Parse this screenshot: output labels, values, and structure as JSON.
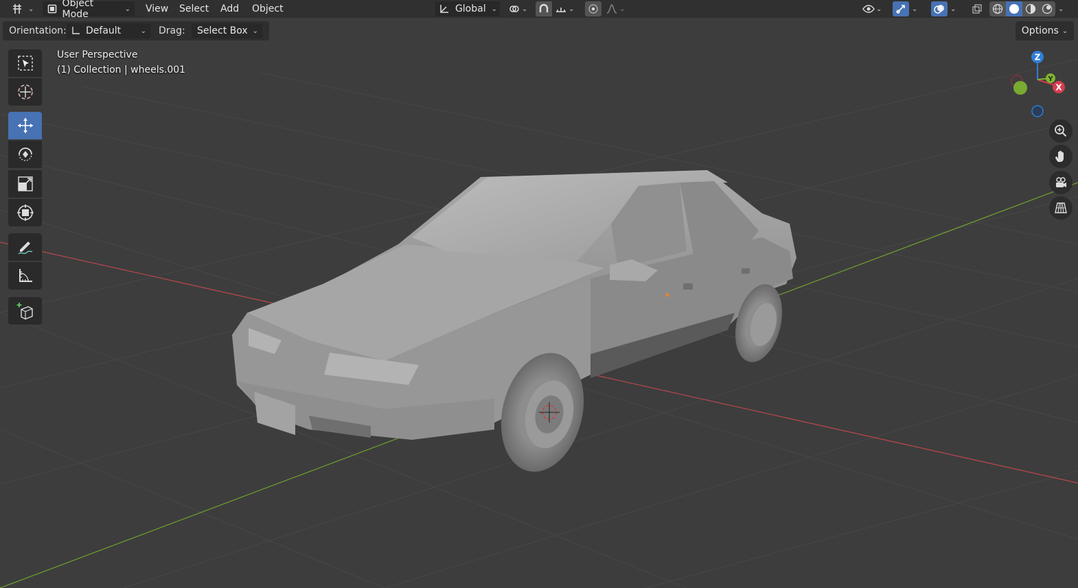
{
  "header": {
    "mode_label": "Object Mode",
    "menu": [
      "View",
      "Select",
      "Add",
      "Object"
    ],
    "transform_orientation": "Global"
  },
  "tool_header": {
    "orientation_label": "Orientation:",
    "orientation_value": "Default",
    "drag_label": "Drag:",
    "drag_value": "Select Box",
    "options_label": "Options"
  },
  "viewport": {
    "view_name": "User Perspective",
    "collection_info": "(1) Collection | wheels.001"
  },
  "tools": [
    {
      "name": "select-box-tool",
      "active": false
    },
    {
      "name": "cursor-tool",
      "active": false
    },
    {
      "name": "move-tool",
      "active": true
    },
    {
      "name": "rotate-tool",
      "active": false
    },
    {
      "name": "scale-tool",
      "active": false
    },
    {
      "name": "transform-tool",
      "active": false
    },
    {
      "name": "annotate-tool",
      "active": false
    },
    {
      "name": "measure-tool",
      "active": false
    },
    {
      "name": "add-cube-tool",
      "active": false
    }
  ],
  "gizmo": {
    "axes": [
      "Z",
      "Y",
      "X"
    ]
  },
  "colors": {
    "accent": "#4772b3",
    "x_axis": "#d43d4e",
    "y_axis": "#7fb630",
    "z_axis": "#2f7ed8"
  }
}
